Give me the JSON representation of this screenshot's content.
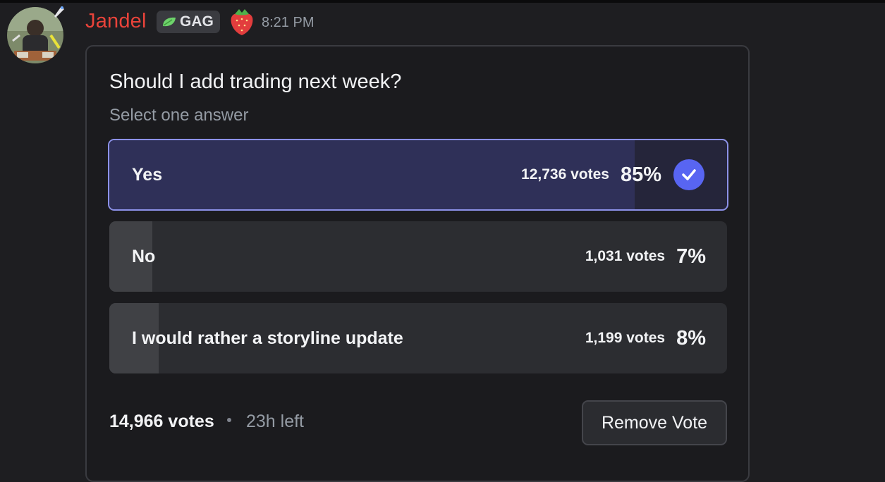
{
  "message": {
    "author": "Jandel",
    "tag": {
      "label": "GAG",
      "icon": "leaf-icon",
      "color": "#6ed36b"
    },
    "emoji": "strawberry",
    "timestamp": "8:21 PM",
    "author_color": "#e9433a"
  },
  "poll": {
    "question": "Should I add trading next week?",
    "instruction": "Select one answer",
    "answers": [
      {
        "label": "Yes",
        "votes": "12,736 votes",
        "percent": "85%",
        "fraction": 0.85,
        "selected": true
      },
      {
        "label": "No",
        "votes": "1,031 votes",
        "percent": "7%",
        "fraction": 0.07,
        "selected": false
      },
      {
        "label": "I would rather a storyline update",
        "votes": "1,199 votes",
        "percent": "8%",
        "fraction": 0.08,
        "selected": false
      }
    ],
    "total_votes": "14,966 votes",
    "time_left": "23h left",
    "remove_vote_label": "Remove Vote",
    "accent_color": "#5865f2"
  }
}
